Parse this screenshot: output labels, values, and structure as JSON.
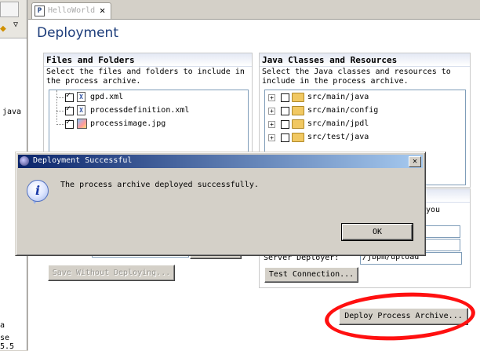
{
  "left_panel": {
    "fragments": [
      "java",
      "a",
      "se 5.5"
    ]
  },
  "editor": {
    "tab_label": "HelloWorld",
    "page_title": "Deployment"
  },
  "files_section": {
    "title": "Files and Folders",
    "description": [
      "Select the files and folders to include in",
      "the process archive."
    ],
    "items": [
      {
        "label": "gpd.xml",
        "checked": true
      },
      {
        "label": "processdefinition.xml",
        "checked": true
      },
      {
        "label": "processimage.jpg",
        "checked": true
      }
    ]
  },
  "classes_section": {
    "title": "Java Classes and Resources",
    "description": [
      "Select the Java classes and resources to",
      "include in the process archive."
    ],
    "items": [
      {
        "label": "src/main/java",
        "checked": false
      },
      {
        "label": "src/main/config",
        "checked": false
      },
      {
        "label": "src/main/jpdl",
        "checked": false
      },
      {
        "label": "src/test/java",
        "checked": false
      }
    ]
  },
  "server_section": {
    "partial_text": "you",
    "server_deployer_label": "Server Deployer:",
    "server_deployer_value": "/jbpm/upload",
    "test_connection_button": "Test Connection..."
  },
  "save_without_deploying_button": "Save Without Deploying...",
  "deploy_button": "Deploy Process Archive...",
  "dialog": {
    "title": "Deployment Successful",
    "message": "The process archive deployed successfully.",
    "ok_button": "OK",
    "close_glyph": "✕",
    "icon_glyph": "i"
  },
  "colors": {
    "title_blue": "#1c3c7a",
    "dialog_titlebar_start": "#0a246a",
    "dialog_titlebar_end": "#a6caf0",
    "highlight_ellipse": "#ff1010"
  }
}
